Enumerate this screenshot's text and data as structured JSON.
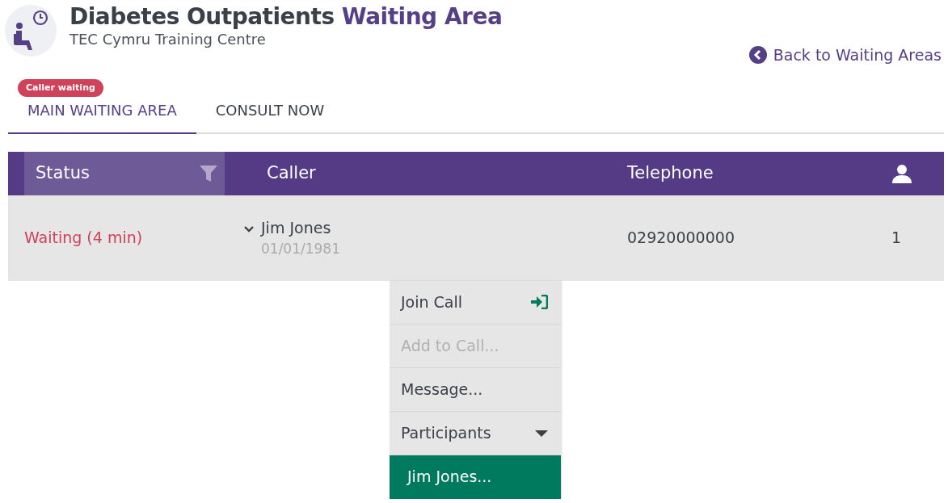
{
  "header": {
    "title_main": "Diabetes Outpatients",
    "title_accent": "Waiting Area",
    "subtitle": "TEC Cymru Training Centre",
    "back_link": "Back to Waiting Areas"
  },
  "tabs": [
    {
      "label": "MAIN WAITING AREA",
      "selected": true,
      "badge": "Caller waiting"
    },
    {
      "label": "CONSULT NOW",
      "selected": false
    }
  ],
  "table": {
    "columns": [
      {
        "kind": "text",
        "label": "Status",
        "filtered": true
      },
      {
        "kind": "text",
        "label": "Caller",
        "filtered": false
      },
      {
        "kind": "text",
        "label": "Telephone",
        "filtered": false
      },
      {
        "kind": "person",
        "filtered": false
      }
    ],
    "rows": [
      {
        "status": "Waiting (4 min)",
        "caller": "Jim Jones",
        "dob": "01/01/1981",
        "telephone": "02920000000",
        "count": "1",
        "expanded": true
      }
    ]
  },
  "action_menu": {
    "items": [
      {
        "label": "Join Call",
        "kind": "join",
        "disabled": false,
        "selected": false
      },
      {
        "label": "Add to Call...",
        "kind": "plain",
        "disabled": true,
        "selected": false
      },
      {
        "label": "Message...",
        "kind": "plain",
        "disabled": false,
        "selected": false
      },
      {
        "label": "Participants",
        "kind": "submenu",
        "disabled": false,
        "selected": false,
        "expanded": true
      },
      {
        "label": "Jim Jones...",
        "kind": "plain",
        "disabled": false,
        "selected": true
      }
    ]
  }
}
